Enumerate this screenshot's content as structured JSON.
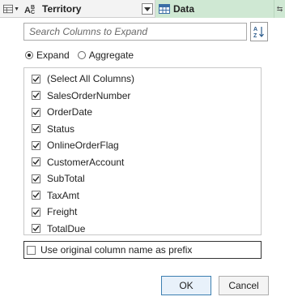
{
  "header": {
    "column1_name": "Territory",
    "column1_type_icon": "abc-icon",
    "column1_type_text": "A B C",
    "column2_name": "Data",
    "column2_type_icon": "table-icon",
    "accent_green": "#cfe8d3"
  },
  "panel": {
    "search_placeholder": "Search Columns to Expand",
    "sort_icon": "sort-az-icon",
    "mode_options": [
      {
        "label": "Expand",
        "selected": true
      },
      {
        "label": "Aggregate",
        "selected": false
      }
    ],
    "columns": [
      {
        "label": "(Select All Columns)",
        "checked": true
      },
      {
        "label": "SalesOrderNumber",
        "checked": true
      },
      {
        "label": "OrderDate",
        "checked": true
      },
      {
        "label": "Status",
        "checked": true
      },
      {
        "label": "OnlineOrderFlag",
        "checked": true
      },
      {
        "label": "CustomerAccount",
        "checked": true
      },
      {
        "label": "SubTotal",
        "checked": true
      },
      {
        "label": "TaxAmt",
        "checked": true
      },
      {
        "label": "Freight",
        "checked": true
      },
      {
        "label": "TotalDue",
        "checked": true
      }
    ],
    "prefix_label": "Use original column name as prefix",
    "prefix_checked": false,
    "ok_label": "OK",
    "cancel_label": "Cancel"
  }
}
